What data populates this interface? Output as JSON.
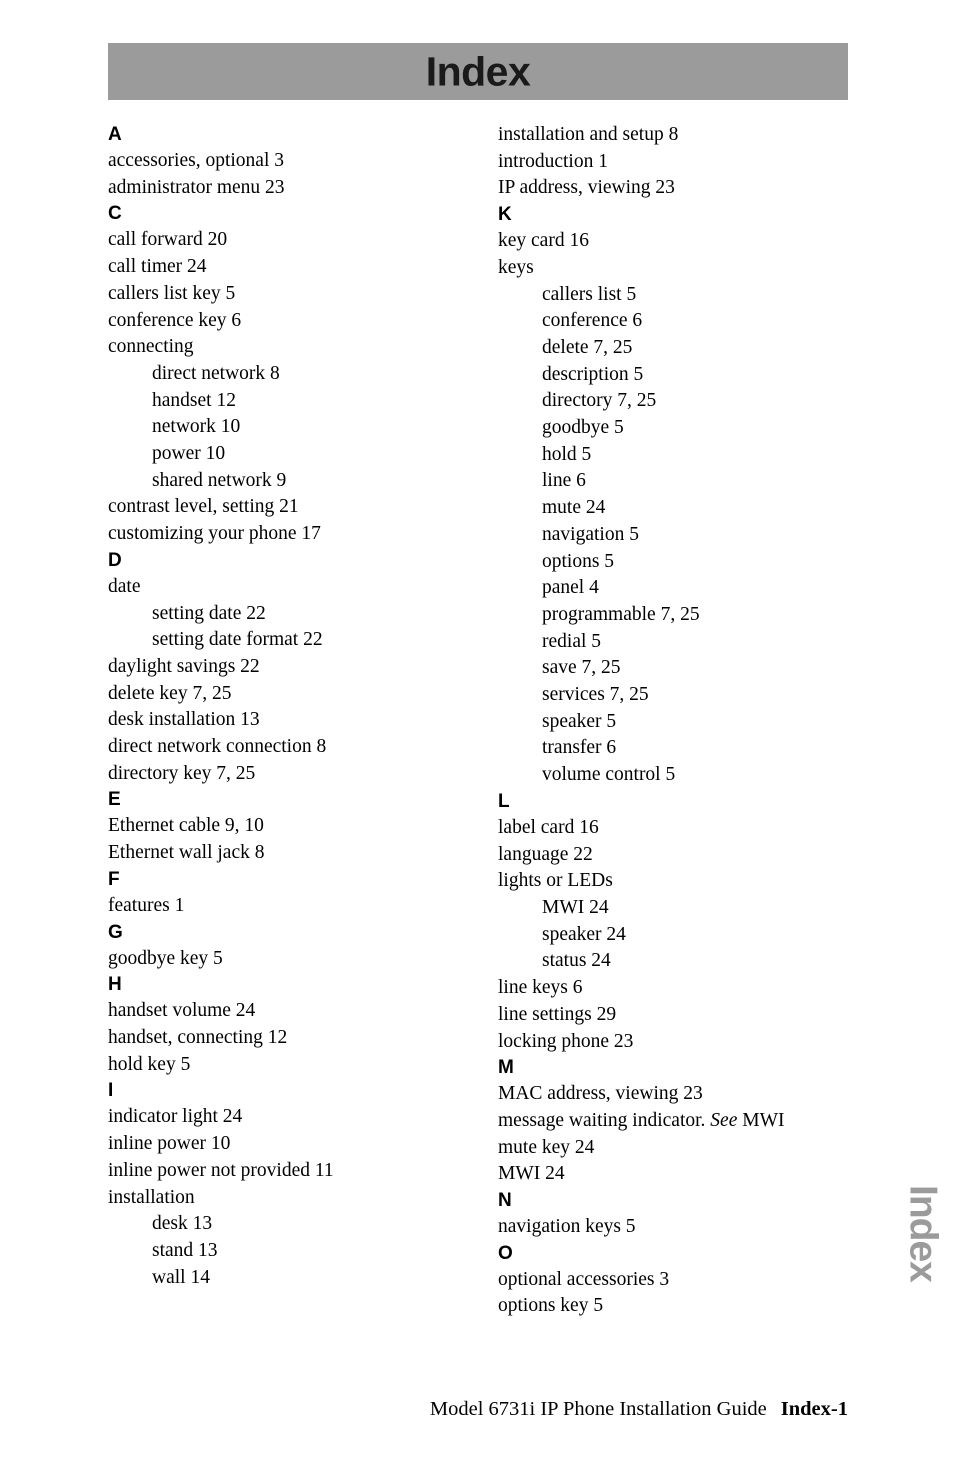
{
  "page": {
    "title": "Index",
    "header_band_color": "#9b9b9b",
    "side_tab_label": "Index",
    "side_tab_color": "#9b9b9b"
  },
  "footer": {
    "guide_title": "Model 6731i IP Phone Installation Guide",
    "page_number": "Index-1"
  },
  "columns": [
    {
      "name": "left",
      "blocks": [
        {
          "type": "letter",
          "text": "A"
        },
        {
          "type": "entry",
          "level": 0,
          "text": "accessories, optional 3"
        },
        {
          "type": "entry",
          "level": 0,
          "text": "administrator menu 23"
        },
        {
          "type": "letter",
          "text": "C"
        },
        {
          "type": "entry",
          "level": 0,
          "text": "call forward 20"
        },
        {
          "type": "entry",
          "level": 0,
          "text": "call timer 24"
        },
        {
          "type": "entry",
          "level": 0,
          "text": "callers list key 5"
        },
        {
          "type": "entry",
          "level": 0,
          "text": "conference key 6"
        },
        {
          "type": "entry",
          "level": 0,
          "text": "connecting"
        },
        {
          "type": "entry",
          "level": 1,
          "text": "direct network 8"
        },
        {
          "type": "entry",
          "level": 1,
          "text": "handset 12"
        },
        {
          "type": "entry",
          "level": 1,
          "text": "network 10"
        },
        {
          "type": "entry",
          "level": 1,
          "text": "power 10"
        },
        {
          "type": "entry",
          "level": 1,
          "text": "shared network 9"
        },
        {
          "type": "entry",
          "level": 0,
          "text": "contrast level, setting 21"
        },
        {
          "type": "entry",
          "level": 0,
          "text": "customizing your phone 17"
        },
        {
          "type": "letter",
          "text": "D"
        },
        {
          "type": "entry",
          "level": 0,
          "text": "date"
        },
        {
          "type": "entry",
          "level": 1,
          "text": "setting date 22"
        },
        {
          "type": "entry",
          "level": 1,
          "text": "setting date format 22"
        },
        {
          "type": "entry",
          "level": 0,
          "text": "daylight savings 22"
        },
        {
          "type": "entry",
          "level": 0,
          "text": "delete key 7, 25"
        },
        {
          "type": "entry",
          "level": 0,
          "text": "desk installation 13"
        },
        {
          "type": "entry",
          "level": 0,
          "text": "direct network connection 8"
        },
        {
          "type": "entry",
          "level": 0,
          "text": "directory key 7, 25"
        },
        {
          "type": "letter",
          "text": "E"
        },
        {
          "type": "entry",
          "level": 0,
          "text": "Ethernet cable 9, 10"
        },
        {
          "type": "entry",
          "level": 0,
          "text": "Ethernet wall jack 8"
        },
        {
          "type": "letter",
          "text": "F"
        },
        {
          "type": "entry",
          "level": 0,
          "text": "features 1"
        },
        {
          "type": "letter",
          "text": "G"
        },
        {
          "type": "entry",
          "level": 0,
          "text": "goodbye key 5"
        },
        {
          "type": "letter",
          "text": "H"
        },
        {
          "type": "entry",
          "level": 0,
          "text": "handset volume 24"
        },
        {
          "type": "entry",
          "level": 0,
          "text": "handset, connecting 12"
        },
        {
          "type": "entry",
          "level": 0,
          "text": "hold key 5"
        },
        {
          "type": "letter",
          "text": "I"
        },
        {
          "type": "entry",
          "level": 0,
          "text": "indicator light 24"
        },
        {
          "type": "entry",
          "level": 0,
          "text": "inline power 10"
        },
        {
          "type": "entry",
          "level": 0,
          "text": "inline power not provided 11"
        },
        {
          "type": "entry",
          "level": 0,
          "text": "installation"
        },
        {
          "type": "entry",
          "level": 1,
          "text": "desk 13"
        },
        {
          "type": "entry",
          "level": 1,
          "text": "stand 13"
        },
        {
          "type": "entry",
          "level": 1,
          "text": "wall 14"
        }
      ]
    },
    {
      "name": "right",
      "blocks": [
        {
          "type": "entry",
          "level": 0,
          "text": "installation and setup 8"
        },
        {
          "type": "entry",
          "level": 0,
          "text": "introduction 1"
        },
        {
          "type": "entry",
          "level": 0,
          "text": "IP address, viewing 23"
        },
        {
          "type": "letter",
          "text": "K"
        },
        {
          "type": "entry",
          "level": 0,
          "text": "key card 16"
        },
        {
          "type": "entry",
          "level": 0,
          "text": "keys"
        },
        {
          "type": "entry",
          "level": 1,
          "text": "callers list 5"
        },
        {
          "type": "entry",
          "level": 1,
          "text": "conference 6"
        },
        {
          "type": "entry",
          "level": 1,
          "text": "delete 7, 25"
        },
        {
          "type": "entry",
          "level": 1,
          "text": "description 5"
        },
        {
          "type": "entry",
          "level": 1,
          "text": "directory 7, 25"
        },
        {
          "type": "entry",
          "level": 1,
          "text": "goodbye 5"
        },
        {
          "type": "entry",
          "level": 1,
          "text": "hold 5"
        },
        {
          "type": "entry",
          "level": 1,
          "text": "line 6"
        },
        {
          "type": "entry",
          "level": 1,
          "text": "mute 24"
        },
        {
          "type": "entry",
          "level": 1,
          "text": "navigation 5"
        },
        {
          "type": "entry",
          "level": 1,
          "text": "options 5"
        },
        {
          "type": "entry",
          "level": 1,
          "text": "panel 4"
        },
        {
          "type": "entry",
          "level": 1,
          "text": "programmable 7, 25"
        },
        {
          "type": "entry",
          "level": 1,
          "text": "redial 5"
        },
        {
          "type": "entry",
          "level": 1,
          "text": "save 7, 25"
        },
        {
          "type": "entry",
          "level": 1,
          "text": "services 7, 25"
        },
        {
          "type": "entry",
          "level": 1,
          "text": "speaker 5"
        },
        {
          "type": "entry",
          "level": 1,
          "text": "transfer 6"
        },
        {
          "type": "entry",
          "level": 1,
          "text": "volume control 5"
        },
        {
          "type": "letter",
          "text": "L"
        },
        {
          "type": "entry",
          "level": 0,
          "text": "label card 16"
        },
        {
          "type": "entry",
          "level": 0,
          "text": "language 22"
        },
        {
          "type": "entry",
          "level": 0,
          "text": "lights or LEDs"
        },
        {
          "type": "entry",
          "level": 1,
          "text": "MWI 24"
        },
        {
          "type": "entry",
          "level": 1,
          "text": "speaker 24"
        },
        {
          "type": "entry",
          "level": 1,
          "text": "status 24"
        },
        {
          "type": "entry",
          "level": 0,
          "text": "line keys 6"
        },
        {
          "type": "entry",
          "level": 0,
          "text": "line settings 29"
        },
        {
          "type": "entry",
          "level": 0,
          "text": "locking phone 23"
        },
        {
          "type": "letter",
          "text": "M"
        },
        {
          "type": "entry",
          "level": 0,
          "text": "MAC address, viewing 23"
        },
        {
          "type": "entry",
          "level": 0,
          "text": "message waiting indicator. ",
          "italic": "See",
          "after": " MWI"
        },
        {
          "type": "entry",
          "level": 0,
          "text": "mute key 24"
        },
        {
          "type": "entry",
          "level": 0,
          "text": "MWI 24"
        },
        {
          "type": "letter",
          "text": "N"
        },
        {
          "type": "entry",
          "level": 0,
          "text": "navigation keys 5"
        },
        {
          "type": "letter",
          "text": "O"
        },
        {
          "type": "entry",
          "level": 0,
          "text": "optional accessories 3"
        },
        {
          "type": "entry",
          "level": 0,
          "text": "options key 5"
        }
      ]
    }
  ]
}
